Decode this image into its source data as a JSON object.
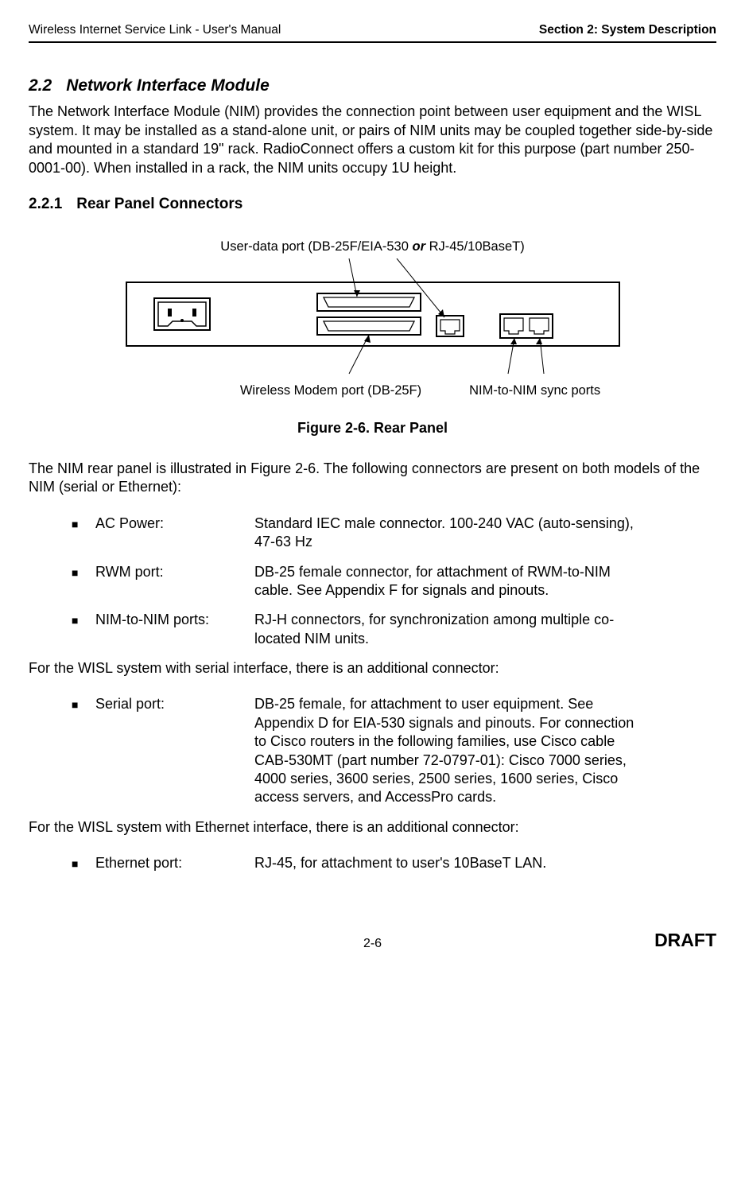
{
  "header": {
    "left": "Wireless Internet Service Link - User's Manual",
    "right": "Section 2: System Description"
  },
  "section": {
    "number": "2.2",
    "title": "Network Interface Module",
    "intro": "The Network Interface Module (NIM) provides the connection point between user equipment and the WISL system.  It may be installed as a stand-alone unit, or pairs of NIM units may be coupled together side-by-side and mounted in a standard 19\" rack.  RadioConnect offers a custom kit for this purpose (part number 250-0001-00).  When installed in a rack, the NIM units occupy 1U height."
  },
  "subsection": {
    "number": "2.2.1",
    "title": "Rear Panel Connectors"
  },
  "figure": {
    "top_label_pre": "User-data port (DB-25F/EIA-530 ",
    "top_label_or": "or",
    "top_label_post": " RJ-45/10BaseT)",
    "bottom_left": "Wireless Modem port (DB-25F)",
    "bottom_right": "NIM-to-NIM sync ports",
    "caption": "Figure 2-6.  Rear Panel"
  },
  "body": {
    "para2": "The NIM rear panel is illustrated in Figure 2-6.  The following connectors are present on both models of the NIM (serial or Ethernet):",
    "list1": [
      {
        "label": "AC Power:",
        "desc": "Standard IEC male connector.\n100-240 VAC (auto-sensing), 47-63 Hz"
      },
      {
        "label": "RWM port:",
        "desc": "DB-25 female connector, for attachment of RWM-to-NIM cable. See Appendix F for signals and pinouts."
      },
      {
        "label": "NIM-to-NIM ports:",
        "desc": "RJ-H connectors, for synchronization among multiple co-located NIM units."
      }
    ],
    "para3": "For the WISL system with serial interface, there is an additional connector:",
    "list2": [
      {
        "label": "Serial port:",
        "desc": "DB-25 female, for attachment to user equipment. See Appendix D for EIA-530 signals and pinouts. For connection to Cisco routers in the following families, use Cisco cable CAB-530MT (part number 72-0797-01): Cisco 7000 series, 4000 series, 3600 series, 2500 series, 1600 series, Cisco access servers, and AccessPro cards."
      }
    ],
    "para4": "For the WISL system with Ethernet interface, there is an additional connector:",
    "list3": [
      {
        "label": "Ethernet port:",
        "desc": "RJ-45, for attachment to user's 10BaseT LAN."
      }
    ]
  },
  "footer": {
    "page": "2-6",
    "status": "DRAFT"
  }
}
